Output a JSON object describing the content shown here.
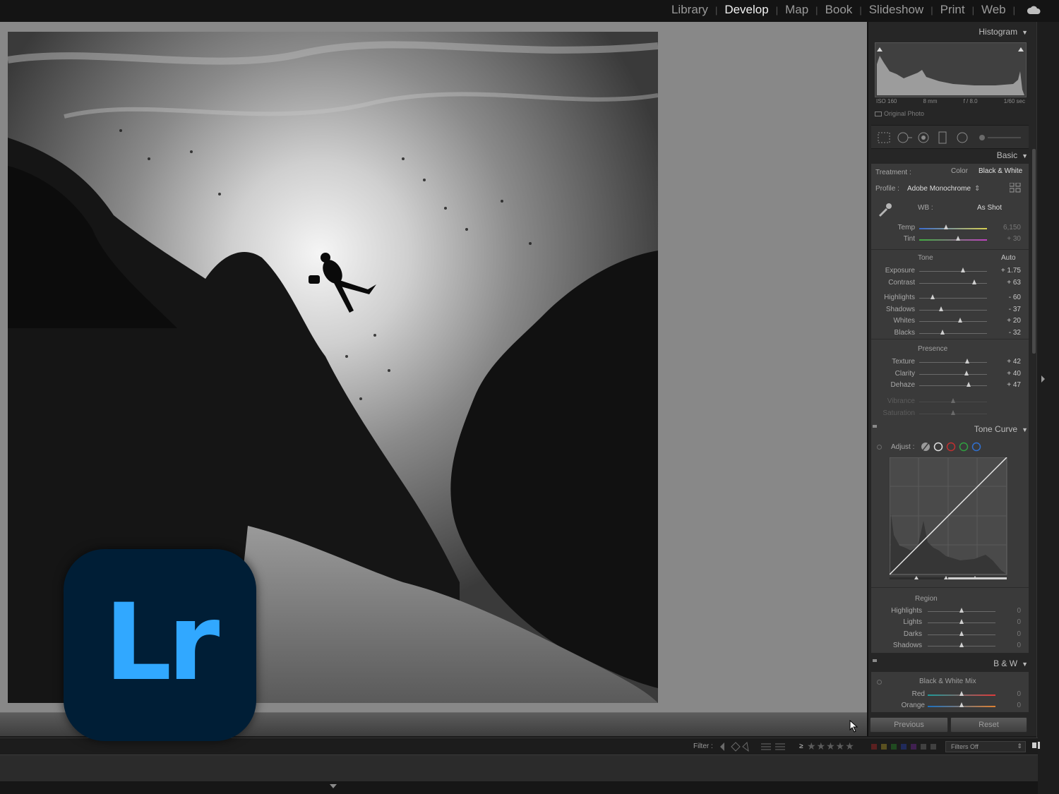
{
  "top_nav": {
    "modules": [
      "Library",
      "Develop",
      "Map",
      "Book",
      "Slideshow",
      "Print",
      "Web"
    ],
    "active": "Develop"
  },
  "histogram": {
    "title": "Histogram",
    "iso": "ISO 160",
    "focal": "8 mm",
    "aperture": "f / 8.0",
    "shutter": "1/60 sec",
    "original_photo": "Original Photo"
  },
  "basic": {
    "title": "Basic",
    "treatment_label": "Treatment :",
    "treatment_color": "Color",
    "treatment_bw": "Black & White",
    "profile_label": "Profile :",
    "profile_value": "Adobe Monochrome",
    "wb_label": "WB :",
    "wb_value": "As Shot",
    "temp_label": "Temp",
    "temp_value": "6,150",
    "tint_label": "Tint",
    "tint_value": "+ 30",
    "tone_label": "Tone",
    "auto_label": "Auto",
    "presence_label": "Presence",
    "sliders": [
      {
        "label": "Exposure",
        "value": "+ 1.75",
        "pos": 0.65
      },
      {
        "label": "Contrast",
        "value": "+ 63",
        "pos": 0.81
      },
      {
        "label": "Highlights",
        "value": "- 60",
        "pos": 0.2
      },
      {
        "label": "Shadows",
        "value": "- 37",
        "pos": 0.32
      },
      {
        "label": "Whites",
        "value": "+ 20",
        "pos": 0.6
      },
      {
        "label": "Blacks",
        "value": "- 32",
        "pos": 0.34
      },
      {
        "label": "Texture",
        "value": "+ 42",
        "pos": 0.71
      },
      {
        "label": "Clarity",
        "value": "+ 40",
        "pos": 0.7
      },
      {
        "label": "Dehaze",
        "value": "+ 47",
        "pos": 0.73
      },
      {
        "label": "Vibrance",
        "value": "",
        "pos": 0.5
      },
      {
        "label": "Saturation",
        "value": "",
        "pos": 0.5
      }
    ],
    "temp_pos": 0.4,
    "tint_pos": 0.57
  },
  "tone_curve": {
    "title": "Tone Curve",
    "adjust_label": "Adjust :",
    "region_label": "Region",
    "regions": [
      {
        "label": "Highlights",
        "value": "0"
      },
      {
        "label": "Lights",
        "value": "0"
      },
      {
        "label": "Darks",
        "value": "0"
      },
      {
        "label": "Shadows",
        "value": "0"
      }
    ]
  },
  "bw": {
    "title": "B & W",
    "mix_label": "Black & White Mix",
    "channels": [
      {
        "label": "Red",
        "value": "0"
      },
      {
        "label": "Orange",
        "value": "0"
      }
    ]
  },
  "buttons": {
    "previous": "Previous",
    "reset": "Reset"
  },
  "filter_bar": {
    "filter_label": "Filter :",
    "gte": "≥",
    "stars": "★★★★★",
    "filters_off": "Filters Off"
  },
  "logo": {
    "text": "Lr"
  },
  "colors": {
    "lr_blue": "#31a8ff",
    "lr_bg": "#001e36"
  }
}
